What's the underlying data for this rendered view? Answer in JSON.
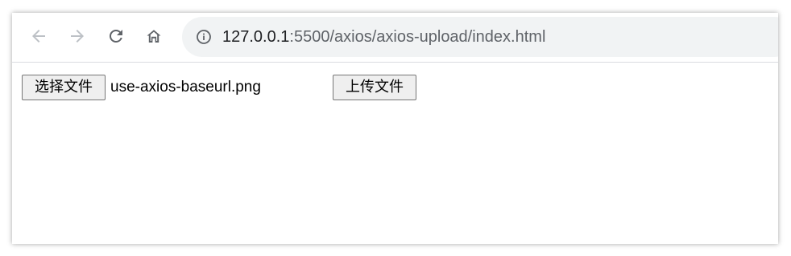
{
  "browser": {
    "address_bar": {
      "host": "127.0.0.1",
      "path": ":5500/axios/axios-upload/index.html"
    },
    "icons": {
      "back": "back-arrow-icon",
      "forward": "forward-arrow-icon",
      "reload": "reload-icon",
      "home": "home-icon",
      "site_info": "info-icon"
    },
    "colors": {
      "omnibox_bg": "#f1f3f4",
      "icon_active": "#5f6368",
      "icon_disabled": "#bdc1c6"
    }
  },
  "page": {
    "file_input": {
      "button_label": "选择文件",
      "selected_file": "use-axios-baseurl.png"
    },
    "upload_button_label": "上传文件"
  }
}
